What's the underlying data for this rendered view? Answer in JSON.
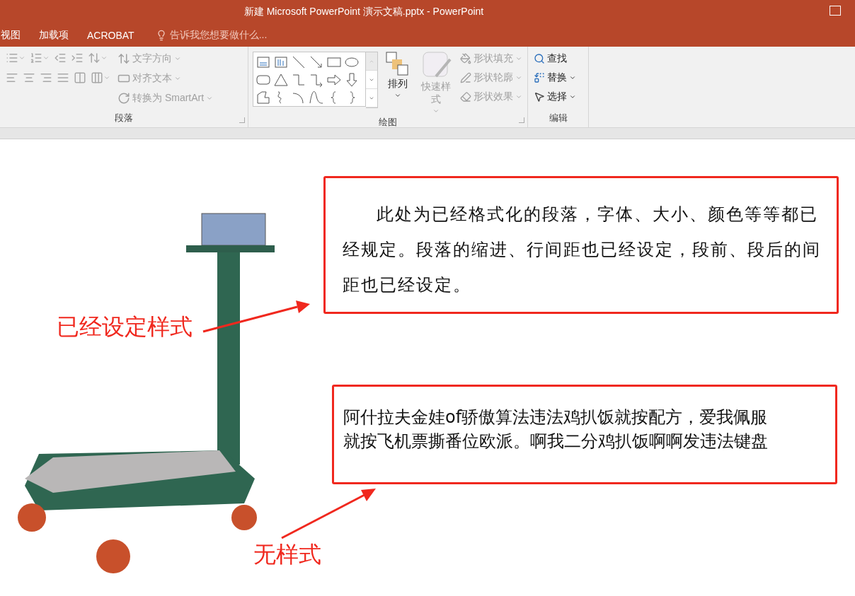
{
  "window": {
    "title": "新建 Microsoft PowerPoint 演示文稿.pptx - PowerPoint"
  },
  "tabs": [
    {
      "label": "视图"
    },
    {
      "label": "加载项"
    },
    {
      "label": "ACROBAT"
    }
  ],
  "tell_me": {
    "placeholder": "告诉我您想要做什么..."
  },
  "ribbon": {
    "paragraph": {
      "label": "段落",
      "disabled": true,
      "commands": [
        {
          "label": "文字方向",
          "disabled": true
        },
        {
          "label": "对齐文本",
          "disabled": true
        },
        {
          "label": "转换为 SmartArt",
          "disabled": true
        }
      ]
    },
    "drawing": {
      "label": "绘图",
      "commands": [
        {
          "kind": "large",
          "label": "排列",
          "disabled": false
        },
        {
          "kind": "large",
          "label": "快速样式",
          "disabled": true
        },
        {
          "kind": "small",
          "label": "形状填充",
          "disabled": true
        },
        {
          "kind": "small",
          "label": "形状轮廓",
          "disabled": true
        },
        {
          "kind": "small",
          "label": "形状效果",
          "disabled": true
        }
      ]
    },
    "editing": {
      "label": "编辑",
      "commands": [
        {
          "label": "查找",
          "disabled": false
        },
        {
          "label": "替换",
          "disabled": false
        },
        {
          "label": "选择",
          "disabled": false
        }
      ]
    }
  },
  "slide": {
    "text_boxes": [
      {
        "kind": "formatted",
        "text": "此处为已经格式化的段落，字体、大小、颜色等等都已经规定。段落的缩进、行间距也已经设定，段前、段后的间距也已经设定。"
      },
      {
        "kind": "plain",
        "text": "阿什拉夫金娃of骄傲算法违法鸡扒饭就按配方，爱我佩服就按飞机票撕番位欧派。啊我二分鸡扒饭啊啊发违法键盘"
      }
    ],
    "labels": [
      "已经设定样式",
      "无样式"
    ]
  }
}
